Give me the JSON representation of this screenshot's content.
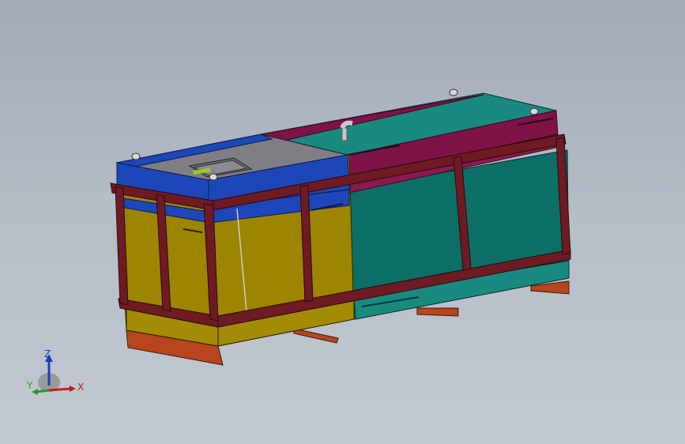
{
  "viewport": {
    "background_top": "#a2abb6",
    "background_bottom": "#c3c9d1"
  },
  "model": {
    "colors": {
      "blue": "#1d47b8",
      "yellow": "#9c8500",
      "teal": "#0b6f66",
      "teal_light": "#1a8a80",
      "magenta": "#7e1346",
      "frame": "#6e1b24",
      "orange": "#b7451d",
      "gray_top": "#7e7e84"
    }
  },
  "triad": {
    "z_label": "Z",
    "y_label": "Y",
    "x_label": "X",
    "z_color": "#1a3fbf",
    "y_color": "#20a020",
    "x_color": "#c02020"
  }
}
